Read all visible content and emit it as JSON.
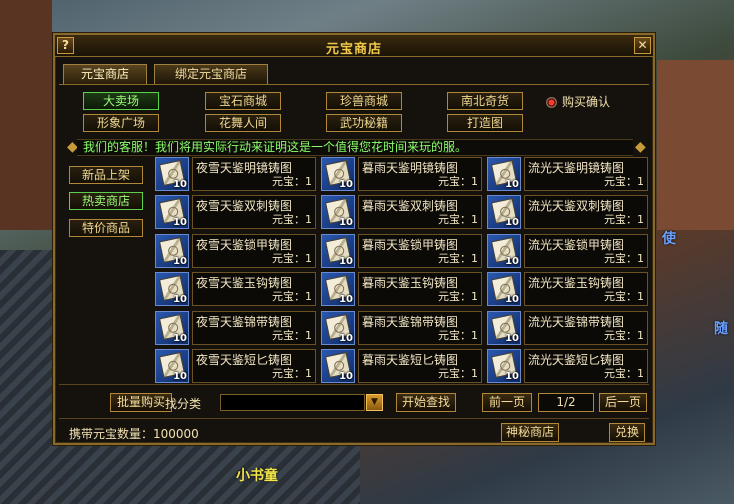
{
  "window": {
    "title": "元宝商店",
    "help_label": "?",
    "close_label": "✕"
  },
  "tabs": [
    {
      "label": "元宝商店",
      "active": true
    },
    {
      "label": "绑定元宝商店",
      "active": false
    }
  ],
  "categories": [
    {
      "label": "大卖场",
      "active": true
    },
    {
      "label": "宝石商城",
      "active": false
    },
    {
      "label": "珍兽商城",
      "active": false
    },
    {
      "label": "南北奇货",
      "active": false
    },
    {
      "label": "形象广场",
      "active": false
    },
    {
      "label": "花舞人间",
      "active": false
    },
    {
      "label": "武功秘籍",
      "active": false
    },
    {
      "label": "打造图",
      "active": false
    }
  ],
  "purchase_confirm": {
    "label": "购买确认",
    "checked": true
  },
  "notice": "我们的客服！我们将用实际行动来证明这是一个值得您花时间来玩的服。",
  "side_menu": [
    {
      "label": "新品上架",
      "active": false
    },
    {
      "label": "热卖商店",
      "active": true
    },
    {
      "label": "特价商品",
      "active": false
    }
  ],
  "items": [
    {
      "name": "夜雪天鉴明镜铸图",
      "price": "元宝：1",
      "qty": "10"
    },
    {
      "name": "暮雨天鉴明镜铸图",
      "price": "元宝：1",
      "qty": "10"
    },
    {
      "name": "流光天鉴明镜铸图",
      "price": "元宝：1",
      "qty": "10"
    },
    {
      "name": "夜雪天鉴双刺铸图",
      "price": "元宝：1",
      "qty": "10"
    },
    {
      "name": "暮雨天鉴双刺铸图",
      "price": "元宝：1",
      "qty": "10"
    },
    {
      "name": "流光天鉴双刺铸图",
      "price": "元宝：1",
      "qty": "10"
    },
    {
      "name": "夜雪天鉴锁甲铸图",
      "price": "元宝：1",
      "qty": "10"
    },
    {
      "name": "暮雨天鉴锁甲铸图",
      "price": "元宝：1",
      "qty": "10"
    },
    {
      "name": "流光天鉴锁甲铸图",
      "price": "元宝：1",
      "qty": "10"
    },
    {
      "name": "夜雪天鉴玉钩铸图",
      "price": "元宝：1",
      "qty": "10"
    },
    {
      "name": "暮雨天鉴玉钩铸图",
      "price": "元宝：1",
      "qty": "10"
    },
    {
      "name": "流光天鉴玉钩铸图",
      "price": "元宝：1",
      "qty": "10"
    },
    {
      "name": "夜雪天鉴锦带铸图",
      "price": "元宝：1",
      "qty": "10"
    },
    {
      "name": "暮雨天鉴锦带铸图",
      "price": "元宝：1",
      "qty": "10"
    },
    {
      "name": "流光天鉴锦带铸图",
      "price": "元宝：1",
      "qty": "10"
    },
    {
      "name": "夜雪天鉴短匕铸图",
      "price": "元宝：1",
      "qty": "10"
    },
    {
      "name": "暮雨天鉴短匕铸图",
      "price": "元宝：1",
      "qty": "10"
    },
    {
      "name": "流光天鉴短匕铸图",
      "price": "元宝：1",
      "qty": "10"
    }
  ],
  "bottom": {
    "bulk_buy_label": "批量购买",
    "search_label": "找分类",
    "search_value": "",
    "start_search_label": "开始查找",
    "prev_label": "前一页",
    "page_indicator": "1/2",
    "next_label": "后一页",
    "currency_label": "携带元宝数量：100000",
    "mystery_shop_label": "神秘商店",
    "exchange_label": "兑换"
  },
  "background_text": {
    "npc_name": "小书童",
    "side_text_1": "使",
    "side_text_2": "随"
  }
}
